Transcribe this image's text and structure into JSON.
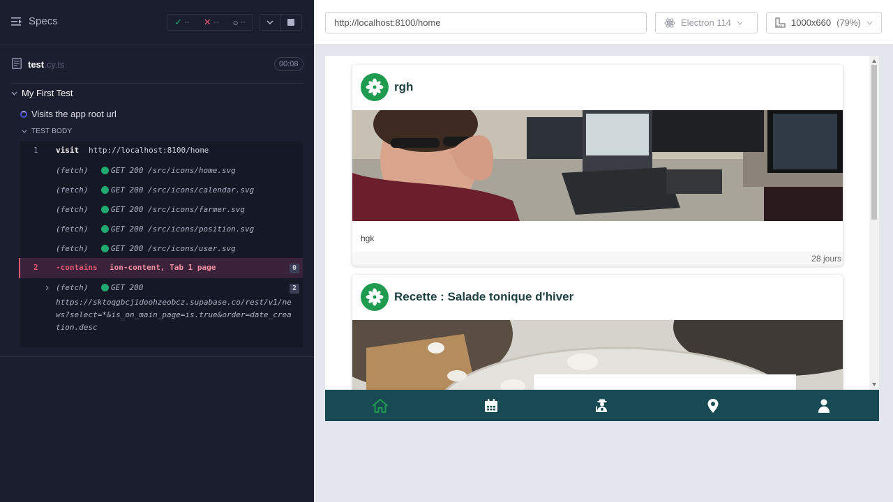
{
  "reporter": {
    "specs_label": "Specs",
    "stats": {
      "passed": "--",
      "failed": "--",
      "pending": "--"
    },
    "spec": {
      "name": "test",
      "ext": ".cy.ts",
      "duration": "00:08"
    },
    "suite_title": "My First Test",
    "test_title": "Visits the app root url",
    "section_label": "TEST BODY",
    "commands": [
      {
        "num": "1",
        "name": "visit",
        "message": "http://localhost:8100/home"
      },
      {
        "num": "",
        "name": "(fetch)",
        "message": "GET 200 /src/icons/home.svg"
      },
      {
        "num": "",
        "name": "(fetch)",
        "message": "GET 200 /src/icons/calendar.svg"
      },
      {
        "num": "",
        "name": "(fetch)",
        "message": "GET 200 /src/icons/farmer.svg"
      },
      {
        "num": "",
        "name": "(fetch)",
        "message": "GET 200 /src/icons/position.svg"
      },
      {
        "num": "",
        "name": "(fetch)",
        "message": "GET 200 /src/icons/user.svg"
      },
      {
        "num": "2",
        "name": "-contains",
        "message": "ion-content, Tab 1 page",
        "badge": "0"
      },
      {
        "num": "",
        "name": "(fetch)",
        "message": "GET 200",
        "badge": "2",
        "detail": "https://sktoqgbcjidoohzeobcz.supabase.co/rest/v1/news?select=*&is_on_main_page=is.true&order=date_creation.desc"
      }
    ]
  },
  "aut": {
    "url": "http://localhost:8100/home",
    "browser": "Electron 114",
    "viewport": "1000x660",
    "scale": "(79%)",
    "cards": [
      {
        "title": "rgh",
        "body": "hgk",
        "date": "28 jours"
      },
      {
        "title": "Recette : Salade tonique d'hiver"
      }
    ],
    "tabs": [
      "home-icon",
      "calendar-icon",
      "farmer-icon",
      "position-icon",
      "user-icon"
    ],
    "colors": {
      "tabbar": "#174a52",
      "active_tab": "#1f9b4f",
      "logo": "#1f9b4f"
    }
  }
}
